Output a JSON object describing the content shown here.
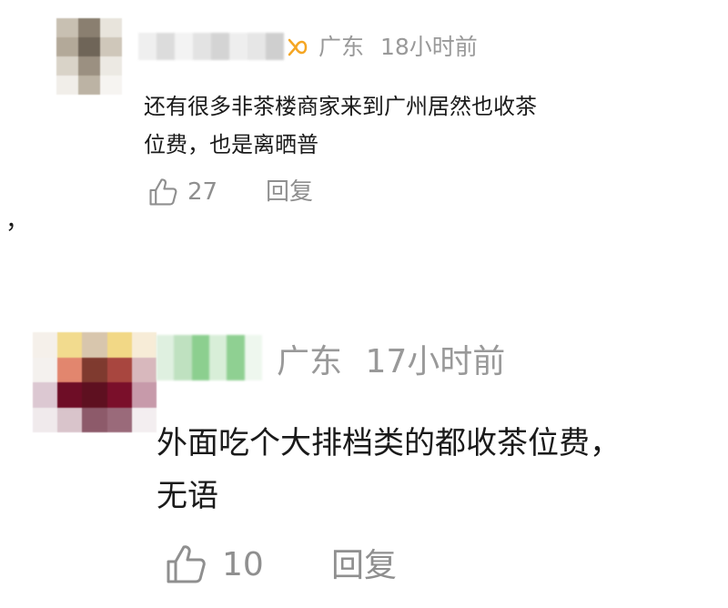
{
  "comments": [
    {
      "location": "广东",
      "time": "18小时前",
      "text_lines": [
        "还有很多非茶楼商家来到广州居然也收茶",
        "位费，也是离晒普"
      ],
      "likes": "27",
      "reply_label": "回复",
      "avatar_colors": [
        "#c8c0b2",
        "#8a7f70",
        "#e8e4dc",
        "#b3a999",
        "#6f6558",
        "#cfc7ba",
        "#d9d3c8",
        "#9b9081",
        "#ece9e3",
        "#f1eee9",
        "#bcb3a4",
        "#f6f4f1"
      ],
      "name_colors": [
        "#efefef",
        "#dcdcdc",
        "#f3f3f3",
        "#e3e3e3",
        "#d4d4d4",
        "#eeeeee",
        "#e6e6e6",
        "#cfcfcf"
      ],
      "level_color": "#f5a623"
    },
    {
      "location": "广东",
      "time": "17小时前",
      "text_lines": [
        "外面吃个大排档类的都收茶位费，",
        "无语"
      ],
      "likes": "10",
      "reply_label": "回复",
      "avatar_colors": [
        "#f5f0ea",
        "#f2db8e",
        "#d8c6ad",
        "#f2d886",
        "#f7ecd7",
        "#f4f1ee",
        "#e2866e",
        "#7f3a2f",
        "#a8463f",
        "#d8b8bd",
        "#dcc8d2",
        "#6e0d26",
        "#5e1020",
        "#7a0f2a",
        "#c79aaa",
        "#f0eaec",
        "#d9c4cb",
        "#8d5a6a",
        "#9a6a7a",
        "#f3eef0"
      ],
      "name_colors": [
        "#dff0e0",
        "#bfe1c0",
        "#8ccf8f",
        "#d8eed8",
        "#8fd092",
        "#eef7ee"
      ]
    }
  ],
  "stray_mark": "，"
}
